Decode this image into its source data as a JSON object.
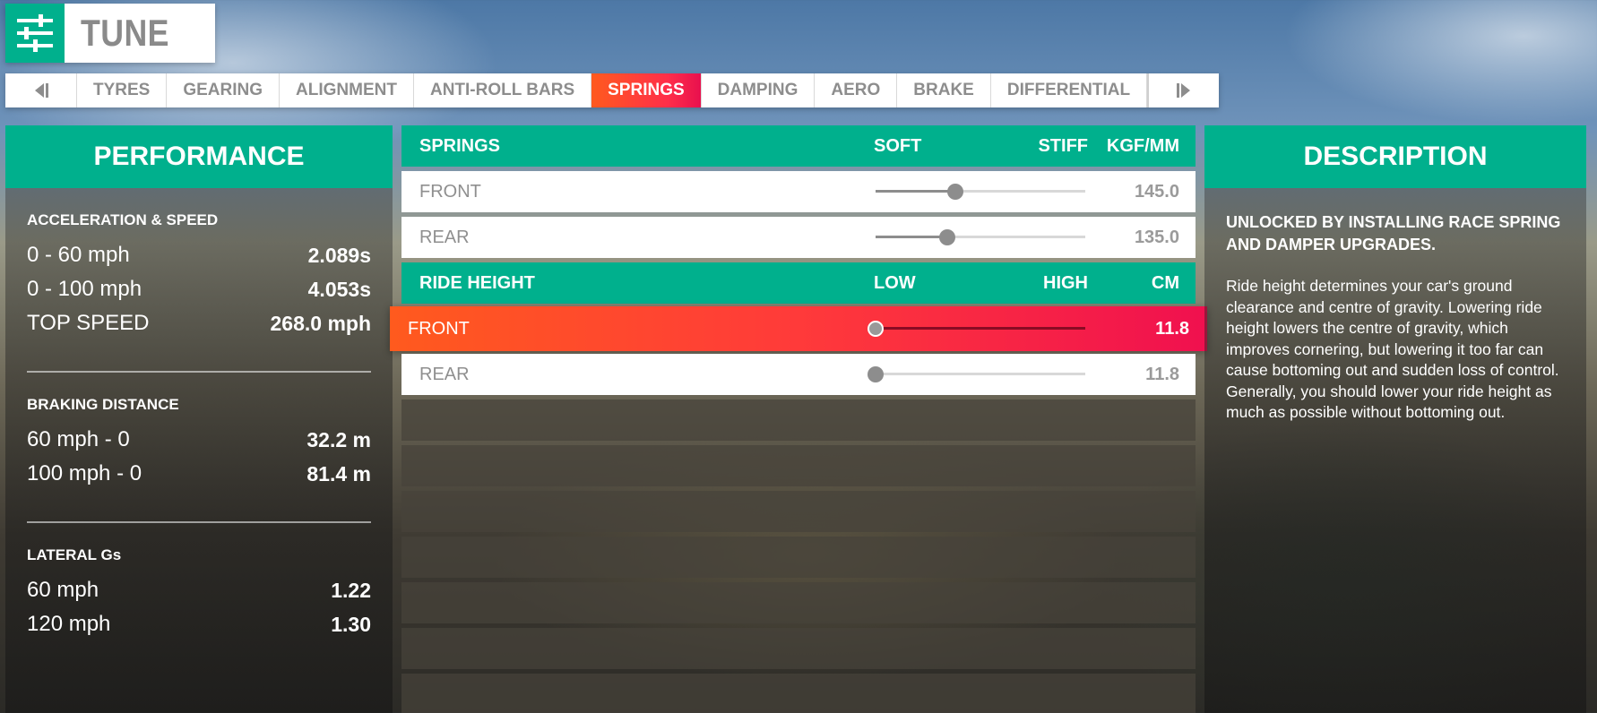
{
  "header": {
    "title": "TUNE",
    "icon": "tune-sliders-icon",
    "accent_color": "#00b08d"
  },
  "tabs": [
    {
      "label": "TYRES",
      "active": false
    },
    {
      "label": "GEARING",
      "active": false
    },
    {
      "label": "ALIGNMENT",
      "active": false
    },
    {
      "label": "ANTI-ROLL BARS",
      "active": false
    },
    {
      "label": "SPRINGS",
      "active": true
    },
    {
      "label": "DAMPING",
      "active": false
    },
    {
      "label": "AERO",
      "active": false
    },
    {
      "label": "BRAKE",
      "active": false
    },
    {
      "label": "DIFFERENTIAL",
      "active": false
    }
  ],
  "performance": {
    "title": "PERFORMANCE",
    "sections": [
      {
        "title": "ACCELERATION & SPEED",
        "rows": [
          {
            "label": "0 - 60 mph",
            "value": "2.089s"
          },
          {
            "label": "0 - 100 mph",
            "value": "4.053s"
          },
          {
            "label": "TOP SPEED",
            "value": "268.0 mph"
          }
        ]
      },
      {
        "title": "BRAKING DISTANCE",
        "rows": [
          {
            "label": "60 mph - 0",
            "value": "32.2 m"
          },
          {
            "label": "100 mph - 0",
            "value": "81.4 m"
          }
        ]
      },
      {
        "title": "LATERAL Gs",
        "rows": [
          {
            "label": "60 mph",
            "value": "1.22"
          },
          {
            "label": "120 mph",
            "value": "1.30"
          }
        ]
      }
    ]
  },
  "springs": {
    "header": {
      "label": "SPRINGS",
      "low": "SOFT",
      "high": "STIFF",
      "unit": "KGF/MM"
    },
    "front": {
      "label": "FRONT",
      "value": "145.0",
      "position": 0.38
    },
    "rear": {
      "label": "REAR",
      "value": "135.0",
      "position": 0.34
    }
  },
  "ride_height": {
    "header": {
      "label": "RIDE HEIGHT",
      "low": "LOW",
      "high": "HIGH",
      "unit": "CM"
    },
    "front": {
      "label": "FRONT",
      "value": "11.8",
      "position": 0.0,
      "selected": true
    },
    "rear": {
      "label": "REAR",
      "value": "11.8",
      "position": 0.0
    }
  },
  "description": {
    "title": "DESCRIPTION",
    "subtitle": "UNLOCKED BY INSTALLING RACE SPRING AND DAMPER UPGRADES.",
    "text": "Ride height determines your car's ground clearance and centre of gravity. Lowering ride height lowers the centre of gravity, which improves cornering, but lowering it too far can cause bottoming out and sudden loss of control. Generally, you should lower your ride height as much as possible without bottoming out."
  }
}
